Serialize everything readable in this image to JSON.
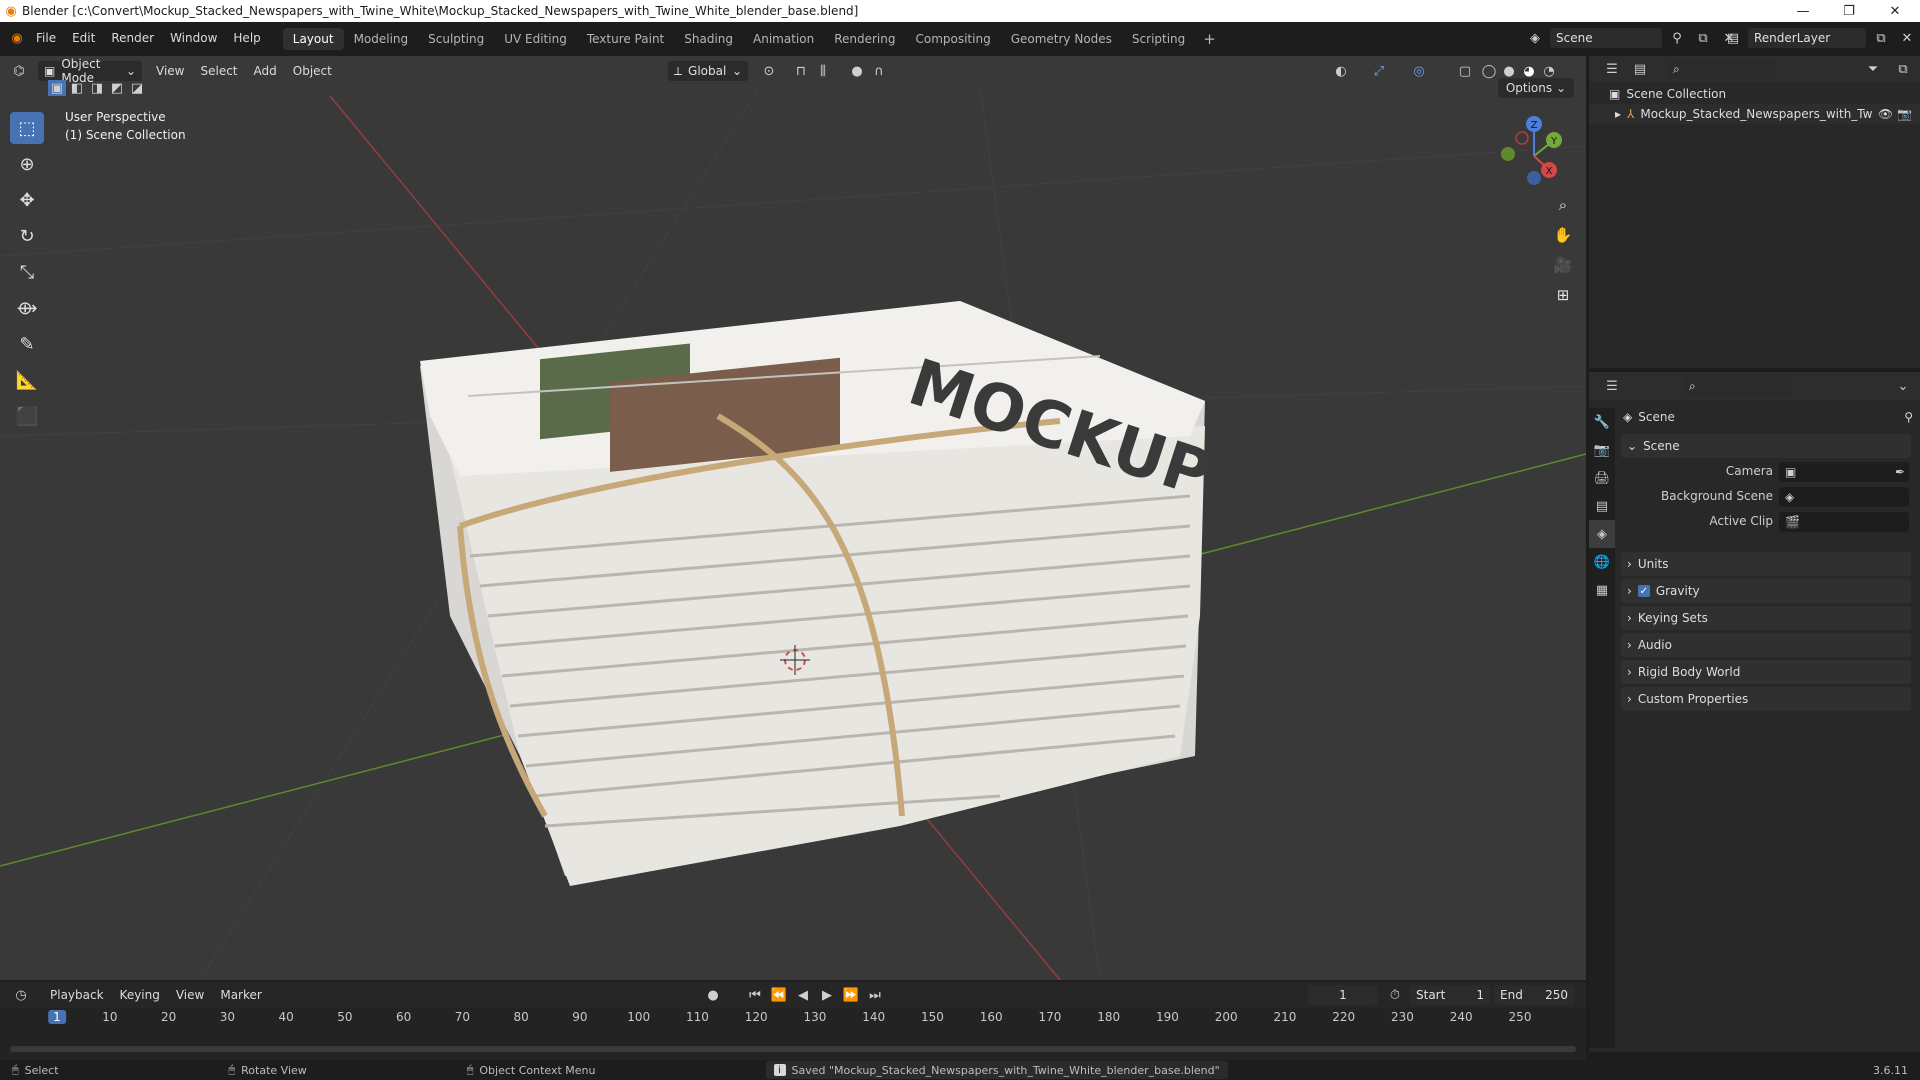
{
  "window": {
    "title": "Blender [c:\\Convert\\Mockup_Stacked_Newspapers_with_Twine_White\\Mockup_Stacked_Newspapers_with_Twine_White_blender_base.blend]"
  },
  "menus": [
    "File",
    "Edit",
    "Render",
    "Window",
    "Help"
  ],
  "workspaces": [
    "Layout",
    "Modeling",
    "Sculpting",
    "UV Editing",
    "Texture Paint",
    "Shading",
    "Animation",
    "Rendering",
    "Compositing",
    "Geometry Nodes",
    "Scripting"
  ],
  "active_workspace": "Layout",
  "scene_name": "Scene",
  "render_layer": "RenderLayer",
  "viewport": {
    "mode": "Object Mode",
    "menus": [
      "View",
      "Select",
      "Add",
      "Object"
    ],
    "transform_orientation": "Global",
    "options_label": "Options",
    "perspective_label": "User Perspective",
    "collection_label": "(1) Scene Collection",
    "mockup_text": "MOCKUP",
    "axis_labels": {
      "x": "X",
      "y": "Y",
      "z": "Z"
    }
  },
  "outliner": {
    "root": "Scene Collection",
    "items": [
      "Mockup_Stacked_Newspapers_with_Tw"
    ]
  },
  "properties": {
    "header": "Scene",
    "section": "Scene",
    "fields": [
      {
        "label": "Camera",
        "value": ""
      },
      {
        "label": "Background Scene",
        "value": ""
      },
      {
        "label": "Active Clip",
        "value": ""
      }
    ],
    "panels": [
      "Units",
      "Gravity",
      "Keying Sets",
      "Audio",
      "Rigid Body World",
      "Custom Properties"
    ],
    "gravity_checked": true
  },
  "timeline": {
    "menus": [
      "Playback",
      "Keying",
      "View",
      "Marker"
    ],
    "current_frame": "1",
    "start_label": "Start",
    "start": "1",
    "end_label": "End",
    "end": "250",
    "ticks": [
      "1",
      "10",
      "20",
      "30",
      "40",
      "50",
      "60",
      "70",
      "80",
      "90",
      "100",
      "110",
      "120",
      "130",
      "140",
      "150",
      "160",
      "170",
      "180",
      "190",
      "200",
      "210",
      "220",
      "230",
      "240",
      "250"
    ]
  },
  "statusbar": {
    "select": "Select",
    "rotate": "Rotate View",
    "context": "Object Context Menu",
    "message": "Saved \"Mockup_Stacked_Newspapers_with_Twine_White_blender_base.blend\"",
    "version": "3.6.11"
  }
}
